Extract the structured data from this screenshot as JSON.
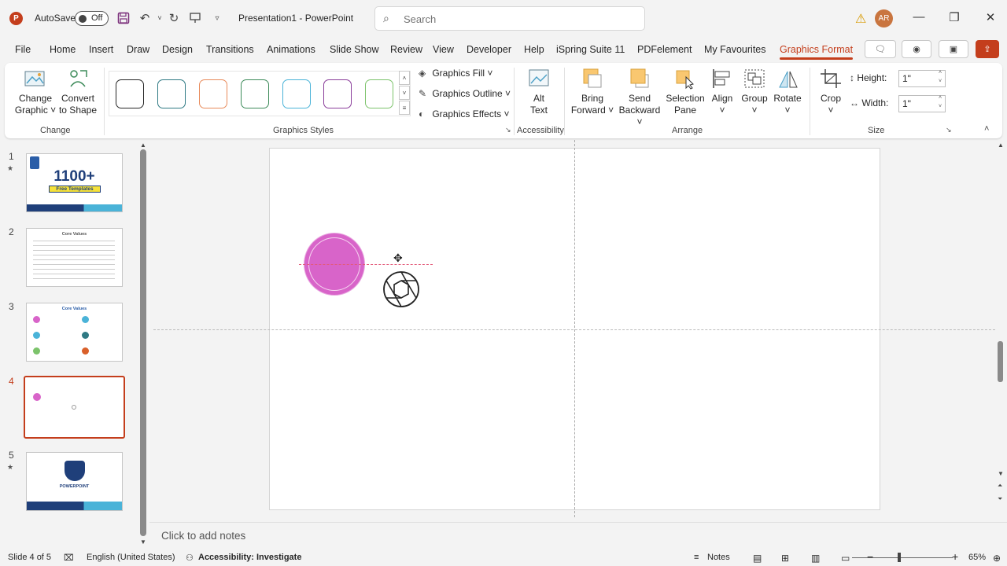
{
  "titlebar": {
    "app_logo": "P",
    "autosave_label": "AutoSave",
    "autosave_state": "Off",
    "doc_title": "Presentation1  -  PowerPoint",
    "search_placeholder": "Search",
    "avatar_initials": "AR"
  },
  "tabs": [
    "File",
    "Home",
    "Insert",
    "Draw",
    "Design",
    "Transitions",
    "Animations",
    "Slide Show",
    "Review",
    "View",
    "Developer",
    "Help",
    "iSpring Suite 11",
    "PDFelement",
    "My Favourites",
    "Graphics Format"
  ],
  "ribbon": {
    "change_group": {
      "change_graphic": [
        "Change",
        "Graphic ˅"
      ],
      "convert_to_shape": [
        "Convert",
        "to Shape"
      ],
      "label": "Change"
    },
    "styles_group": {
      "label": "Graphics Styles",
      "swatch_colors": [
        "#262626",
        "#2f7a84",
        "#e88a5a",
        "#3d8b5a",
        "#4ab3d8",
        "#8a3d9a",
        "#7cc36b"
      ],
      "graphics_fill": "Graphics Fill ˅",
      "graphics_outline": "Graphics Outline ˅",
      "graphics_effects": "Graphics Effects ˅"
    },
    "accessibility_group": {
      "alt_text": [
        "Alt",
        "Text"
      ],
      "label": "Accessibility"
    },
    "arrange_group": {
      "bring_forward": [
        "Bring",
        "Forward ˅"
      ],
      "send_backward": [
        "Send",
        "Backward ˅"
      ],
      "selection_pane": [
        "Selection",
        "Pane"
      ],
      "align": [
        "Align",
        "˅"
      ],
      "group": [
        "Group",
        "˅"
      ],
      "rotate": [
        "Rotate",
        "˅"
      ],
      "label": "Arrange"
    },
    "size_group": {
      "crop": [
        "Crop",
        "˅"
      ],
      "height_label": "Height:",
      "height_value": "1\"",
      "width_label": "Width:",
      "width_value": "1\"",
      "label": "Size"
    }
  },
  "thumbnails": [
    {
      "num": "1",
      "star": "★",
      "big_text": "1100+",
      "sub_text": "Free Templates"
    },
    {
      "num": "2",
      "star": "",
      "title": "Core Values"
    },
    {
      "num": "3",
      "star": "",
      "title": "Core Values"
    },
    {
      "num": "4",
      "star": "",
      "title": ""
    },
    {
      "num": "5",
      "star": "★",
      "title": "POWERPOINT"
    }
  ],
  "notes_placeholder": "Click to add notes",
  "statusbar": {
    "slide_info": "Slide 4 of 5",
    "language": "English (United States)",
    "accessibility": "Accessibility: Investigate",
    "notes_label": "Notes",
    "zoom_level": "65%"
  },
  "colors": {
    "accent": "#c43e1c",
    "circle_fill": "#d864c9"
  }
}
